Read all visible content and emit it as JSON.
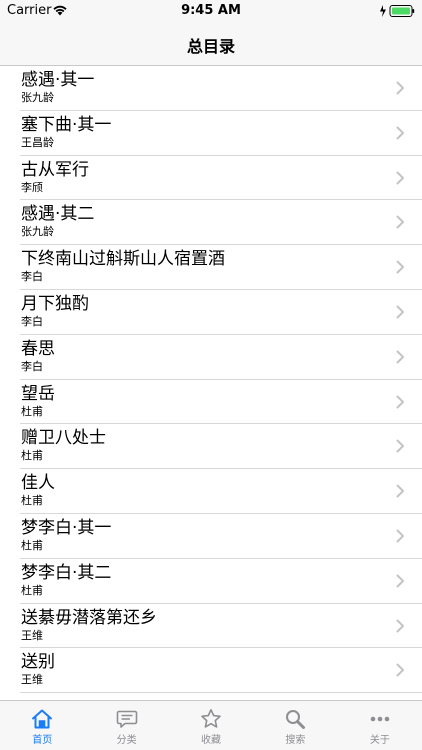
{
  "status_bar": {
    "carrier": "Carrier",
    "time": "9:45 AM"
  },
  "nav": {
    "title": "总目录"
  },
  "poems": [
    {
      "title": "感遇·其一",
      "author": "张九龄"
    },
    {
      "title": "塞下曲·其一",
      "author": "王昌龄"
    },
    {
      "title": "古从军行",
      "author": "李颀"
    },
    {
      "title": "感遇·其二",
      "author": "张九龄"
    },
    {
      "title": "下终南山过斛斯山人宿置酒",
      "author": "李白"
    },
    {
      "title": "月下独酌",
      "author": "李白"
    },
    {
      "title": "春思",
      "author": "李白"
    },
    {
      "title": "望岳",
      "author": "杜甫"
    },
    {
      "title": "赠卫八处士",
      "author": "杜甫"
    },
    {
      "title": "佳人",
      "author": "杜甫"
    },
    {
      "title": "梦李白·其一",
      "author": "杜甫"
    },
    {
      "title": "梦李白·其二",
      "author": "杜甫"
    },
    {
      "title": "送綦毋潜落第还乡",
      "author": "王维"
    },
    {
      "title": "送别",
      "author": "王维"
    }
  ],
  "tab_bar": {
    "tabs": [
      {
        "label": "首页",
        "icon": "home-icon",
        "active": true
      },
      {
        "label": "分类",
        "icon": "chat-bubble-icon",
        "active": false
      },
      {
        "label": "收藏",
        "icon": "star-icon",
        "active": false
      },
      {
        "label": "搜索",
        "icon": "search-icon",
        "active": false
      },
      {
        "label": "关于",
        "icon": "more-icon",
        "active": false
      }
    ]
  },
  "colors": {
    "accent": "#1a7cf6",
    "inactive": "#8e8e93",
    "bar_background": "#f7f7f7",
    "battery_green": "#4cd964"
  }
}
